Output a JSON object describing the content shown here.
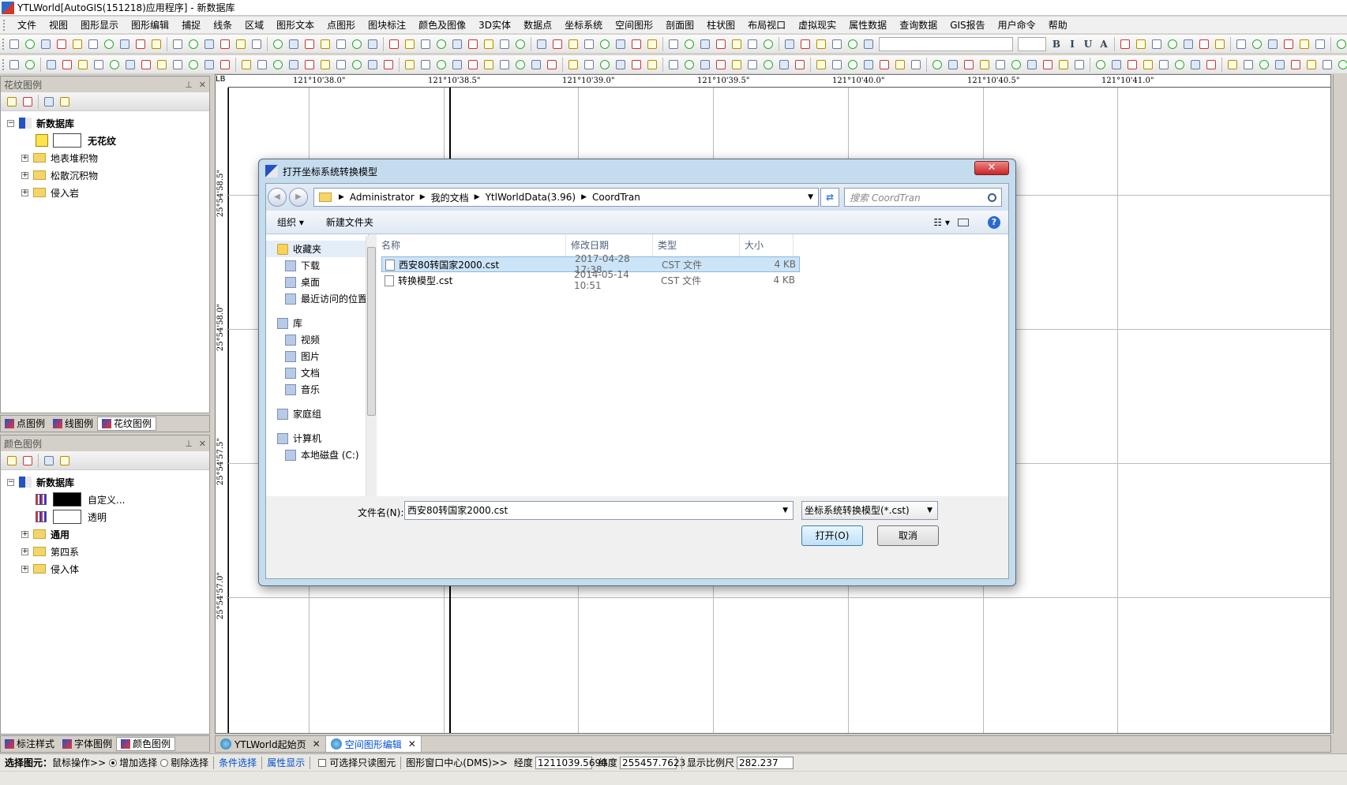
{
  "app": {
    "title": "YTLWorld[AutoGIS(151218)应用程序] - 新数据库"
  },
  "menu": [
    "文件",
    "视图",
    "图形显示",
    "图形编辑",
    "捕捉",
    "线条",
    "区域",
    "图形文本",
    "点图形",
    "图块标注",
    "颜色及图像",
    "3D实体",
    "数据点",
    "坐标系统",
    "空间图形",
    "剖面图",
    "柱状图",
    "布局视口",
    "虚拟现实",
    "属性数据",
    "查询数据",
    "GIS报告",
    "用户命令",
    "帮助"
  ],
  "top_panel": {
    "title": "花纹图例",
    "root": "新数据库",
    "items": [
      {
        "label": "无花纹",
        "kind": "pattern"
      },
      {
        "label": "地表堆积物",
        "kind": "folder"
      },
      {
        "label": "松散沉积物",
        "kind": "folder"
      },
      {
        "label": "侵入岩",
        "kind": "folder"
      }
    ],
    "tabs": [
      "点图例",
      "线图例",
      "花纹图例"
    ]
  },
  "bottom_panel": {
    "title": "颜色图例",
    "root": "新数据库",
    "items": [
      {
        "label": "自定义...",
        "kind": "color",
        "color": "#000000"
      },
      {
        "label": "透明",
        "kind": "color",
        "color": "#ffffff"
      },
      {
        "label": "通用",
        "kind": "folder",
        "bold": true
      },
      {
        "label": "第四系",
        "kind": "folder"
      },
      {
        "label": "侵入体",
        "kind": "folder"
      }
    ],
    "tabs": [
      "标注样式",
      "字体图例",
      "颜色图例"
    ]
  },
  "map": {
    "corner_label": "LB",
    "lon_ticks": [
      "121°10'38.0\"",
      "121°10'38.5\"",
      "121°10'39.0\"",
      "121°10'39.5\"",
      "121°10'40.0\"",
      "121°10'40.5\"",
      "121°10'41.0\""
    ],
    "lat_ticks": [
      "25°54'58.5\"",
      "25°54'58.0\"",
      "25°54'57.5\"",
      "25°54'57.0\""
    ]
  },
  "doc_tabs": [
    {
      "label": "YTLWorld起始页",
      "active": false
    },
    {
      "label": "空间图形编辑",
      "active": true
    }
  ],
  "status": {
    "select_label": "选择图元：",
    "mouse_op": "鼠标操作>>",
    "add_select": "增加选择",
    "remove_select": "剔除选择",
    "condition_select": "条件选择",
    "attr_display": "属性显示",
    "readonly_select": "可选择只读图元",
    "center_label": "图形窗口中心(DMS)>>",
    "lon_label": "经度",
    "lon_value": "1211039.5690",
    "lat_label": "纬度",
    "lat_value": "255457.7623",
    "scale_label": "显示比例尺",
    "scale_value": "282.237"
  },
  "dialog": {
    "title": "打开坐标系统转换模型",
    "breadcrumbs": [
      "Administrator",
      "我的文档",
      "YtlWorldData(3.96)",
      "CoordTran"
    ],
    "search_placeholder": "搜索 CoordTran",
    "organize": "组织",
    "new_folder": "新建文件夹",
    "nav": [
      {
        "label": "收藏夹",
        "group": true,
        "star": true
      },
      {
        "label": "下载"
      },
      {
        "label": "桌面"
      },
      {
        "label": "最近访问的位置"
      },
      {
        "label": "库",
        "group": true
      },
      {
        "label": "视频"
      },
      {
        "label": "图片"
      },
      {
        "label": "文档"
      },
      {
        "label": "音乐"
      },
      {
        "label": "家庭组",
        "group": true
      },
      {
        "label": "计算机",
        "group": true
      },
      {
        "label": "本地磁盘 (C:)"
      }
    ],
    "columns": [
      "名称",
      "修改日期",
      "类型",
      "大小"
    ],
    "files": [
      {
        "name": "西安80转国家2000.cst",
        "date": "2017-04-28 17:38",
        "type": "CST 文件",
        "size": "4 KB",
        "selected": true
      },
      {
        "name": "转换模型.cst",
        "date": "2014-05-14 10:51",
        "type": "CST 文件",
        "size": "4 KB",
        "selected": false
      }
    ],
    "filename_label": "文件名(N):",
    "filename_value": "西安80转国家2000.cst",
    "filter_value": "坐标系统转换模型(*.cst)",
    "open_button": "打开(O)",
    "cancel_button": "取消"
  }
}
